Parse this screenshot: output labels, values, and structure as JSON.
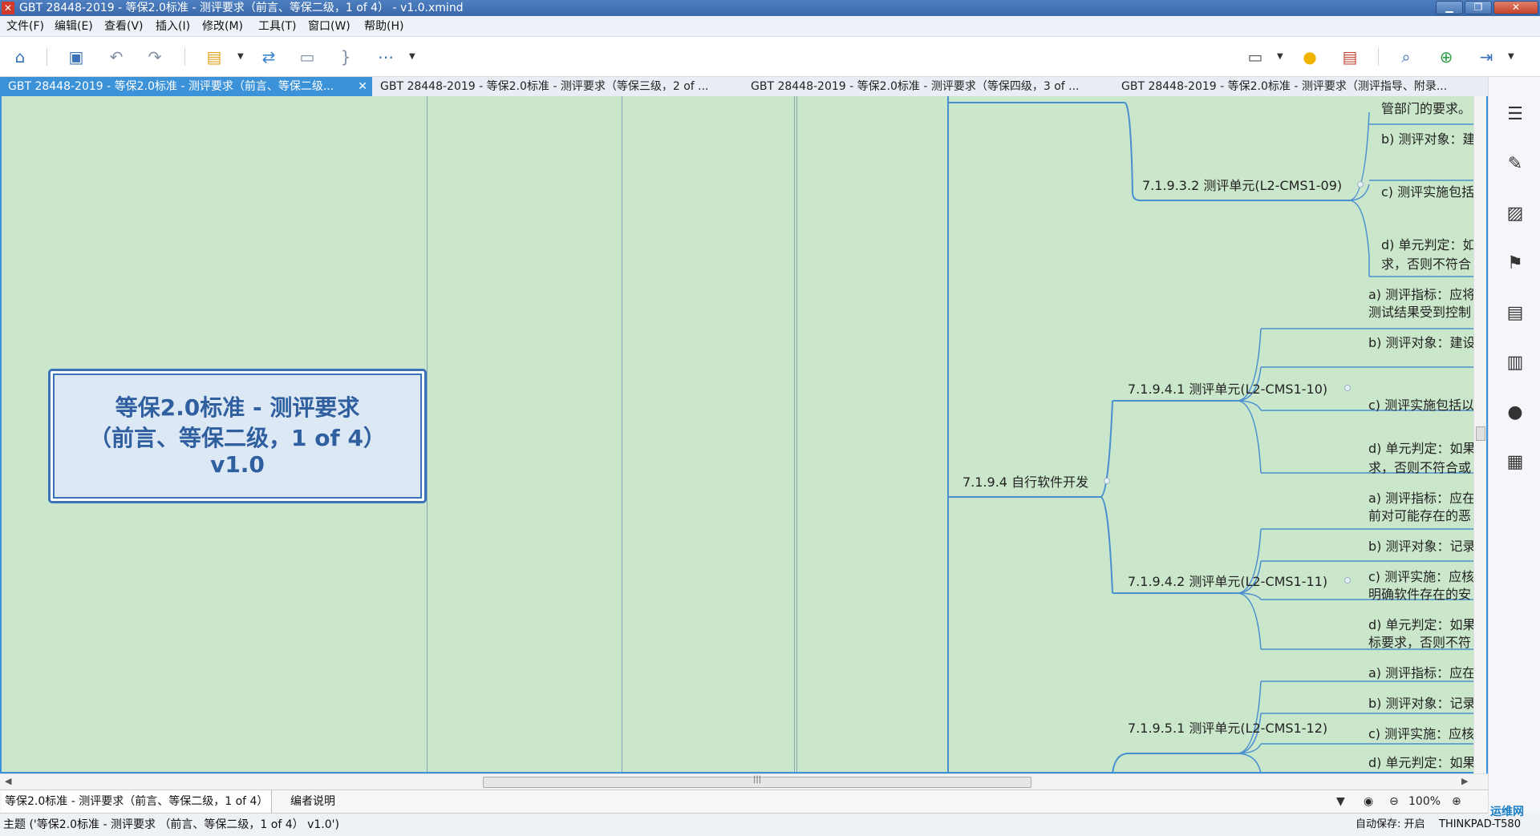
{
  "window": {
    "title": "GBT 28448-2019 - 等保2.0标准 - 测评要求（前言、等保二级，1 of 4） - v1.0.xmind",
    "app_icon": "xmind-icon",
    "buttons": {
      "minimize": "▁",
      "maximize": "❐",
      "close": "✕"
    }
  },
  "menu": [
    "文件(F)",
    "编辑(E)",
    "查看(V)",
    "插入(I)",
    "修改(M)",
    "工具(T)",
    "窗口(W)",
    "帮助(H)"
  ],
  "toolbar": {
    "icons": [
      "home-icon",
      "save-icon",
      "undo-icon",
      "redo-icon",
      "topic-style-icon",
      "relationship-icon",
      "boundary-icon",
      "summary-icon",
      "more-icon",
      "presentation-icon",
      "idea-icon",
      "gantt-icon",
      "search-icon",
      "share-icon",
      "export-icon"
    ]
  },
  "tabs": [
    {
      "label": "GBT 28448-2019 - 等保2.0标准 - 测评要求（前言、等保二级...",
      "active": true,
      "close": "✕"
    },
    {
      "label": "GBT 28448-2019 - 等保2.0标准 - 测评要求（等保三级，2 of ...",
      "active": false
    },
    {
      "label": "GBT 28448-2019 - 等保2.0标准 - 测评要求（等保四级，3 of ...",
      "active": false
    },
    {
      "label": "GBT 28448-2019 - 等保2.0标准 - 测评要求（测评指导、附录...",
      "active": false
    }
  ],
  "mindmap": {
    "central": {
      "lines": [
        "等保2.0标准 - 测评要求",
        "（前言、等保二级，1 of 4）",
        "v1.0"
      ]
    },
    "branch": "7.1.9.4 自行软件开发",
    "units": [
      "7.1.9.3.2 测评单元(L2-CMS1-09)",
      "7.1.9.4.1 测评单元(L2-CMS1-10)",
      "7.1.9.4.2 测评单元(L2-CMS1-11)",
      "7.1.9.5.1 测评单元(L2-CMS1-12)"
    ],
    "leaves": [
      "管部门的要求。",
      "b) 测评对象：建",
      "c) 测评实施包括",
      "d) 单元判定：如",
      "求，否则不符合",
      "a) 测评指标：应将",
      "测试结果受到控制",
      "b) 测评对象：建设",
      "c) 测评实施包括以",
      "d) 单元判定：如果",
      "求，否则不符合或",
      "a) 测评指标：应在",
      "前对可能存在的恶",
      "b) 测评对象：记录",
      "c) 测评实施：应核",
      "明确软件存在的安",
      "d) 单元判定：如果",
      "标要求，否则不符",
      "a) 测评指标：应在",
      "b) 测评对象：记录",
      "c) 测评实施：应核",
      "d) 单元判定：如果",
      "标要求，否则不符"
    ]
  },
  "sidebar": {
    "icons": [
      "outline-icon",
      "format-brush-icon",
      "image-icon",
      "flag-icon",
      "text-style-icon",
      "notes-icon",
      "comment-icon",
      "task-icon"
    ]
  },
  "sheets": [
    {
      "label": "等保2.0标准 - 测评要求（前言、等保二级，1 of 4）",
      "active": true
    },
    {
      "label": "编者说明",
      "active": false
    }
  ],
  "zoom": {
    "value": "100%",
    "minus": "⊖",
    "plus": "⊕"
  },
  "status": {
    "left": "主题 ('等保2.0标准 - 测评要求 （前言、等保二级，1 of 4） v1.0')",
    "autosave": "自动保存: 开启",
    "user": "THINKPAD-T580",
    "watermark": "运维网"
  }
}
